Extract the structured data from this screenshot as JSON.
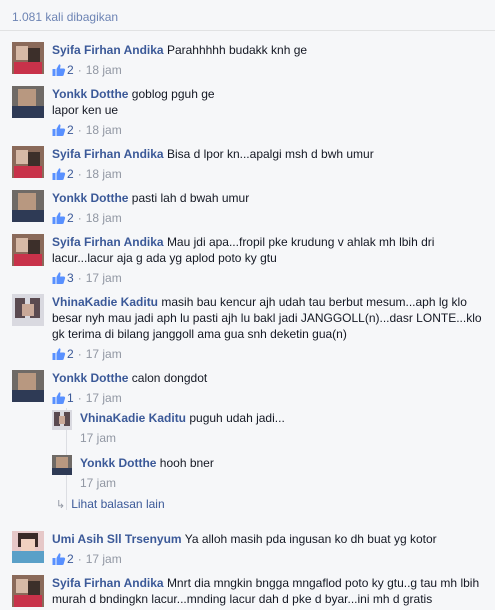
{
  "shares_text": "1.081 kali dibagikan",
  "colors": {
    "link": "#3b5998",
    "meta": "#9197a3"
  },
  "comments": [
    {
      "name": "Syifa Firhan Andika",
      "text": "Parahhhhh budakk knh ge",
      "likes": "2",
      "time": "18 jam"
    },
    {
      "name": "Yonkk Dotthe",
      "text": "goblog pguh ge",
      "text2": "lapor ken ue",
      "likes": "2",
      "time": "18 jam"
    },
    {
      "name": "Syifa Firhan Andika",
      "text": "Bisa d lpor kn...apalgi msh d bwh umur",
      "likes": "2",
      "time": "18 jam"
    },
    {
      "name": "Yonkk Dotthe",
      "text": "pasti lah d bwah umur",
      "likes": "2",
      "time": "18 jam"
    },
    {
      "name": "Syifa Firhan Andika",
      "text": "Mau jdi apa...fropil pke krudung v ahlak mh lbih dri lacur...lacur aja g ada yg aplod poto ky gtu",
      "likes": "3",
      "time": "17 jam"
    },
    {
      "name": "VhinaKadie Kaditu",
      "text": "masih bau kencur ajh udah tau berbut mesum...aph lg klo besar nyh mau jadi aph lu pasti ajh lu bakl jadi JANGGOLL(n)...dasr LONTE...klo gk terima di bilang janggoll ama gua snh deketin gua(n)",
      "likes": "2",
      "time": "17 jam"
    },
    {
      "name": "Yonkk Dotthe",
      "text": "calon dongdot",
      "likes": "1",
      "time": "17 jam"
    },
    {
      "name": "Umi Asih Sll Trsenyum",
      "text": "Ya alloh masih pda ingusan ko dh buat yg kotor",
      "likes": "2",
      "time": "17 jam"
    },
    {
      "name": "Syifa Firhan Andika",
      "text": "Mnrt dia mngkin bngga mngaflod poto ky gtu..g tau mh lbih murah d bndingkn lacur...mnding lacur dah d pke d byar...ini mh d gratis"
    }
  ],
  "replies": [
    {
      "name": "VhinaKadie Kaditu",
      "text": "puguh udah jadi...",
      "time": "17 jam"
    },
    {
      "name": "Yonkk Dotthe",
      "text": "hooh bner",
      "time": "17 jam"
    }
  ],
  "view_replies_label": "Lihat balasan lain"
}
